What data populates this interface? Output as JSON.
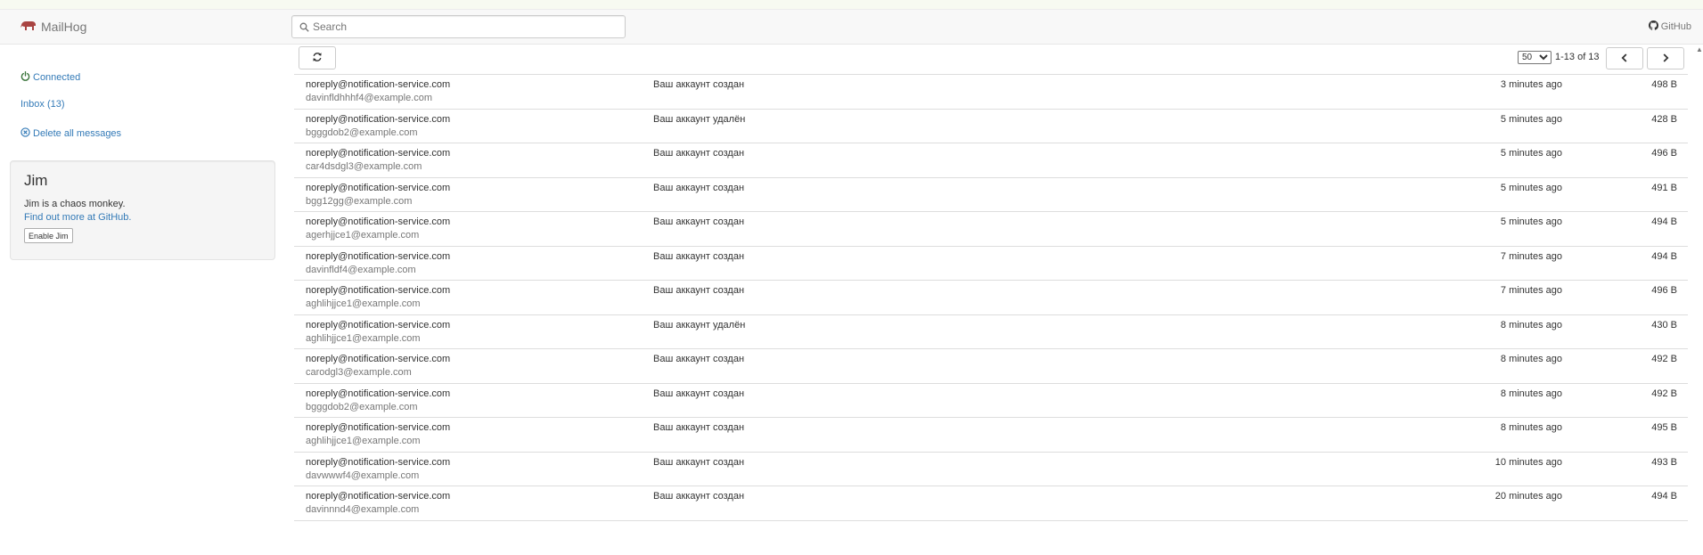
{
  "brand": {
    "name": "MailHog",
    "accent": "#a94442"
  },
  "header": {
    "search_placeholder": "Search",
    "github_label": "GitHub"
  },
  "sidebar": {
    "connected_label": "Connected",
    "connected_color": "#3c763d",
    "inbox_label": "Inbox (13)",
    "delete_label": "Delete all messages",
    "link_color": "#337ab7"
  },
  "jim": {
    "title": "Jim",
    "description": "Jim is a chaos monkey.",
    "link": "Find out more at GitHub.",
    "button": "Enable Jim"
  },
  "toolbar": {
    "per_page_value": "50",
    "range_text": "1-13 of 13"
  },
  "messages": [
    {
      "from": "noreply@notification-service.com",
      "to": "davinfldhhhf4@example.com",
      "subject": "Ваш аккаунт создан",
      "time": "3 minutes ago",
      "size": "498 B"
    },
    {
      "from": "noreply@notification-service.com",
      "to": "bgggdob2@example.com",
      "subject": "Ваш аккаунт удалён",
      "time": "5 minutes ago",
      "size": "428 B"
    },
    {
      "from": "noreply@notification-service.com",
      "to": "car4dsdgl3@example.com",
      "subject": "Ваш аккаунт создан",
      "time": "5 minutes ago",
      "size": "496 B"
    },
    {
      "from": "noreply@notification-service.com",
      "to": "bgg12gg@example.com",
      "subject": "Ваш аккаунт создан",
      "time": "5 minutes ago",
      "size": "491 B"
    },
    {
      "from": "noreply@notification-service.com",
      "to": "agerhjjce1@example.com",
      "subject": "Ваш аккаунт создан",
      "time": "5 minutes ago",
      "size": "494 B"
    },
    {
      "from": "noreply@notification-service.com",
      "to": "davinfldf4@example.com",
      "subject": "Ваш аккаунт создан",
      "time": "7 minutes ago",
      "size": "494 B"
    },
    {
      "from": "noreply@notification-service.com",
      "to": "aghlihjjce1@example.com",
      "subject": "Ваш аккаунт создан",
      "time": "7 minutes ago",
      "size": "496 B"
    },
    {
      "from": "noreply@notification-service.com",
      "to": "aghlihjjce1@example.com",
      "subject": "Ваш аккаунт удалён",
      "time": "8 minutes ago",
      "size": "430 B"
    },
    {
      "from": "noreply@notification-service.com",
      "to": "carodgl3@example.com",
      "subject": "Ваш аккаунт создан",
      "time": "8 minutes ago",
      "size": "492 B"
    },
    {
      "from": "noreply@notification-service.com",
      "to": "bgggdob2@example.com",
      "subject": "Ваш аккаунт создан",
      "time": "8 minutes ago",
      "size": "492 B"
    },
    {
      "from": "noreply@notification-service.com",
      "to": "aghlihjjce1@example.com",
      "subject": "Ваш аккаунт создан",
      "time": "8 minutes ago",
      "size": "495 B"
    },
    {
      "from": "noreply@notification-service.com",
      "to": "davwwwf4@example.com",
      "subject": "Ваш аккаунт создан",
      "time": "10 minutes ago",
      "size": "493 B"
    },
    {
      "from": "noreply@notification-service.com",
      "to": "davinnnd4@example.com",
      "subject": "Ваш аккаунт создан",
      "time": "20 minutes ago",
      "size": "494 B"
    }
  ]
}
